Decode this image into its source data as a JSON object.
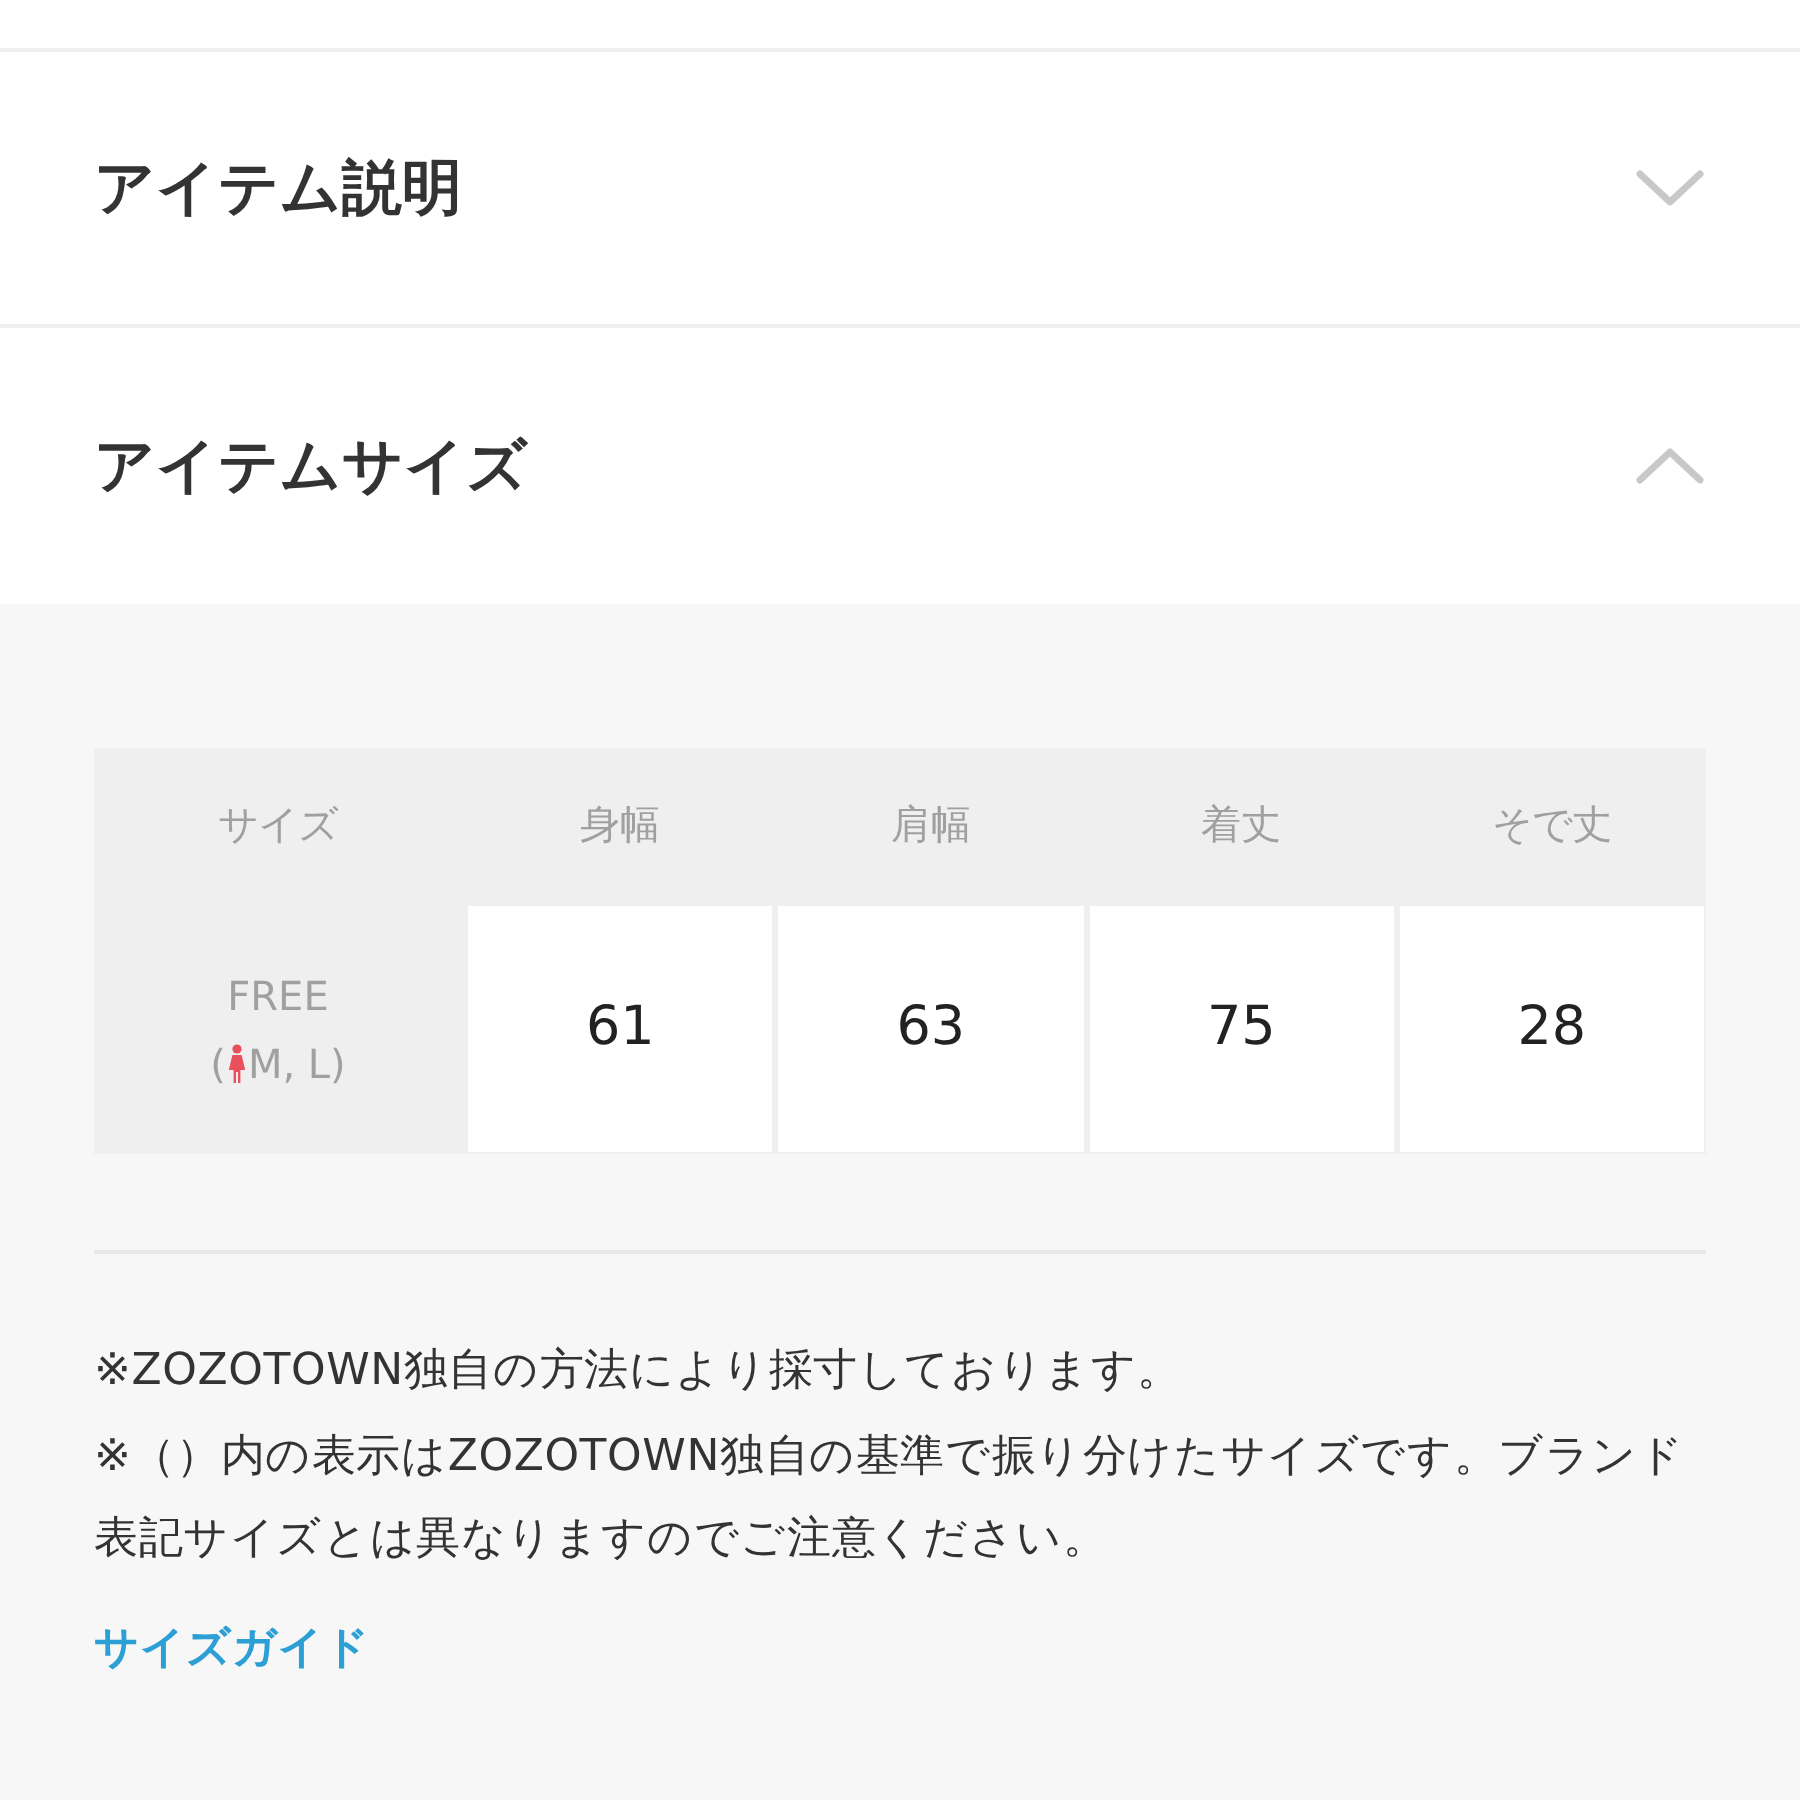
{
  "sections": [
    {
      "title": "アイテム説明",
      "expanded": false
    },
    {
      "title": "アイテムサイズ",
      "expanded": true,
      "size_table": {
        "columns": [
          "サイズ",
          "身幅",
          "肩幅",
          "着丈",
          "そで丈"
        ],
        "rows": [
          {
            "size": "FREE",
            "size_note_open": "(",
            "size_note": "M, L)",
            "values": [
              "61",
              "63",
              "75",
              "28"
            ]
          }
        ]
      },
      "notes": [
        "※ZOZOTOWN独自の方法により採寸しております。",
        "※（）内の表示はZOZOTOWN独自の基準で振り分けたサイズです。ブランド表記サイズとは異なりますのでご注意ください。"
      ],
      "link": "サイズガイド"
    }
  ]
}
